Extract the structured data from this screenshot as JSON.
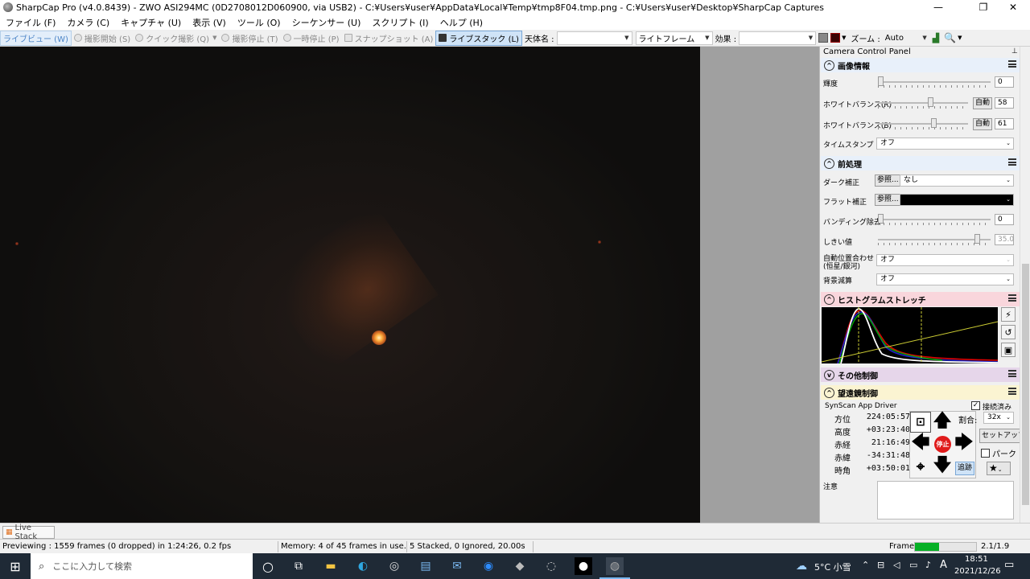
{
  "window": {
    "title": "SharpCap Pro (v4.0.8439) - ZWO ASI294MC (0D2708012D060900, via USB2) - C:¥Users¥user¥AppData¥Local¥Temp¥tmp8F04.tmp.png - C:¥Users¥user¥Desktop¥SharpCap Captures",
    "minimize": "—",
    "maximize": "❐",
    "close": "✕"
  },
  "menu": [
    "ファイル (F)",
    "カメラ (C)",
    "キャプチャ (U)",
    "表示 (V)",
    "ツール (O)",
    "シーケンサー (U)",
    "スクリプト (I)",
    "ヘルプ (H)"
  ],
  "toolbar": {
    "liveview": "ライブビュー (W)",
    "start_capture": "撮影開始 (S)",
    "quick_capture": "クイック撮影 (Q)",
    "stop_capture": "撮影停止 (T)",
    "pause": "一時停止 (P)",
    "snapshot": "スナップショット (A)",
    "live_stack": "ライブスタック (L)",
    "target_label": "天体名 :",
    "target_value": "",
    "frame_type": "ライトフレーム",
    "effect_label": "効果 :",
    "effect_value": "",
    "zoom_label": "ズーム :",
    "zoom_value": "Auto"
  },
  "panel": {
    "title": "Camera Control Panel",
    "image_info": {
      "header": "画像情報",
      "brightness_label": "輝度",
      "brightness_value": "0",
      "brightness_level": 0.0,
      "wb_r_label": "ホワイトバランス(R)",
      "wb_r_auto": "自動",
      "wb_r_value": "58",
      "wb_r_level": 0.58,
      "wb_b_label": "ホワイトバランス(B)",
      "wb_b_auto": "自動",
      "wb_b_value": "61",
      "wb_b_level": 0.61,
      "timestamp_label": "タイムスタンプ",
      "timestamp_value": "オフ"
    },
    "preprocess": {
      "header": "前処理",
      "dark_label": "ダーク補正",
      "dark_browse": "参照...",
      "dark_value": "なし",
      "flat_label": "フラット補正",
      "flat_browse": "参照...",
      "flat_value": "",
      "banding_label": "バンディング除去",
      "banding_value": "0",
      "banding_level": 0.0,
      "threshold_label": "しきい値",
      "threshold_value": "35.0",
      "threshold_level": 0.88,
      "align_label_1": "自動位置合わせ",
      "align_label_2": "(恒星/銀河)",
      "align_value": "オフ",
      "bg_label": "背景減算",
      "bg_value": "オフ"
    },
    "histogram": {
      "header": "ヒストグラムストレッチ"
    },
    "other": {
      "header": "その他制御"
    },
    "telescope": {
      "header": "望遠鏡制御",
      "driver": "SynScan App Driver",
      "connected": "接続済み",
      "rows": [
        {
          "label": "方位",
          "value": "224:05:57"
        },
        {
          "label": "高度",
          "value": "+03:23:40"
        },
        {
          "label": "赤経",
          "value": "21:16:49"
        },
        {
          "label": "赤緯",
          "value": "-34:31:48"
        },
        {
          "label": "時角",
          "value": "+03:50:01"
        }
      ],
      "rate_label": "割合:",
      "rate_value": "32x",
      "setup": "セットアップ",
      "stop": "停止",
      "park": "パーク",
      "track": "追跡",
      "notes_label": "注意"
    }
  },
  "bottom": {
    "live_stack_tab": "Live Stack"
  },
  "status": {
    "preview": "Previewing : 1559 frames (0 dropped) in 1:24:26, 0.2 fps",
    "memory": "Memory: 4 of 45 frames in use.",
    "stacked": "5 Stacked, 0 Ignored, 20.00s",
    "frame_label": "Frame:",
    "frame_ratio": "2.1/1.9",
    "frame_progress": 0.4
  },
  "taskbar": {
    "search_placeholder": "ここに入力して検索",
    "weather": "5°C 小雪",
    "time": "18:51",
    "date": "2021/12/26",
    "ime": "A"
  },
  "colors": {
    "accent": "#4b84c7",
    "histo_header": "#f9d6dc",
    "other_header": "#e6d6ea",
    "telescope_header": "#fbf4d2",
    "stop_red": "#e01b1b"
  }
}
